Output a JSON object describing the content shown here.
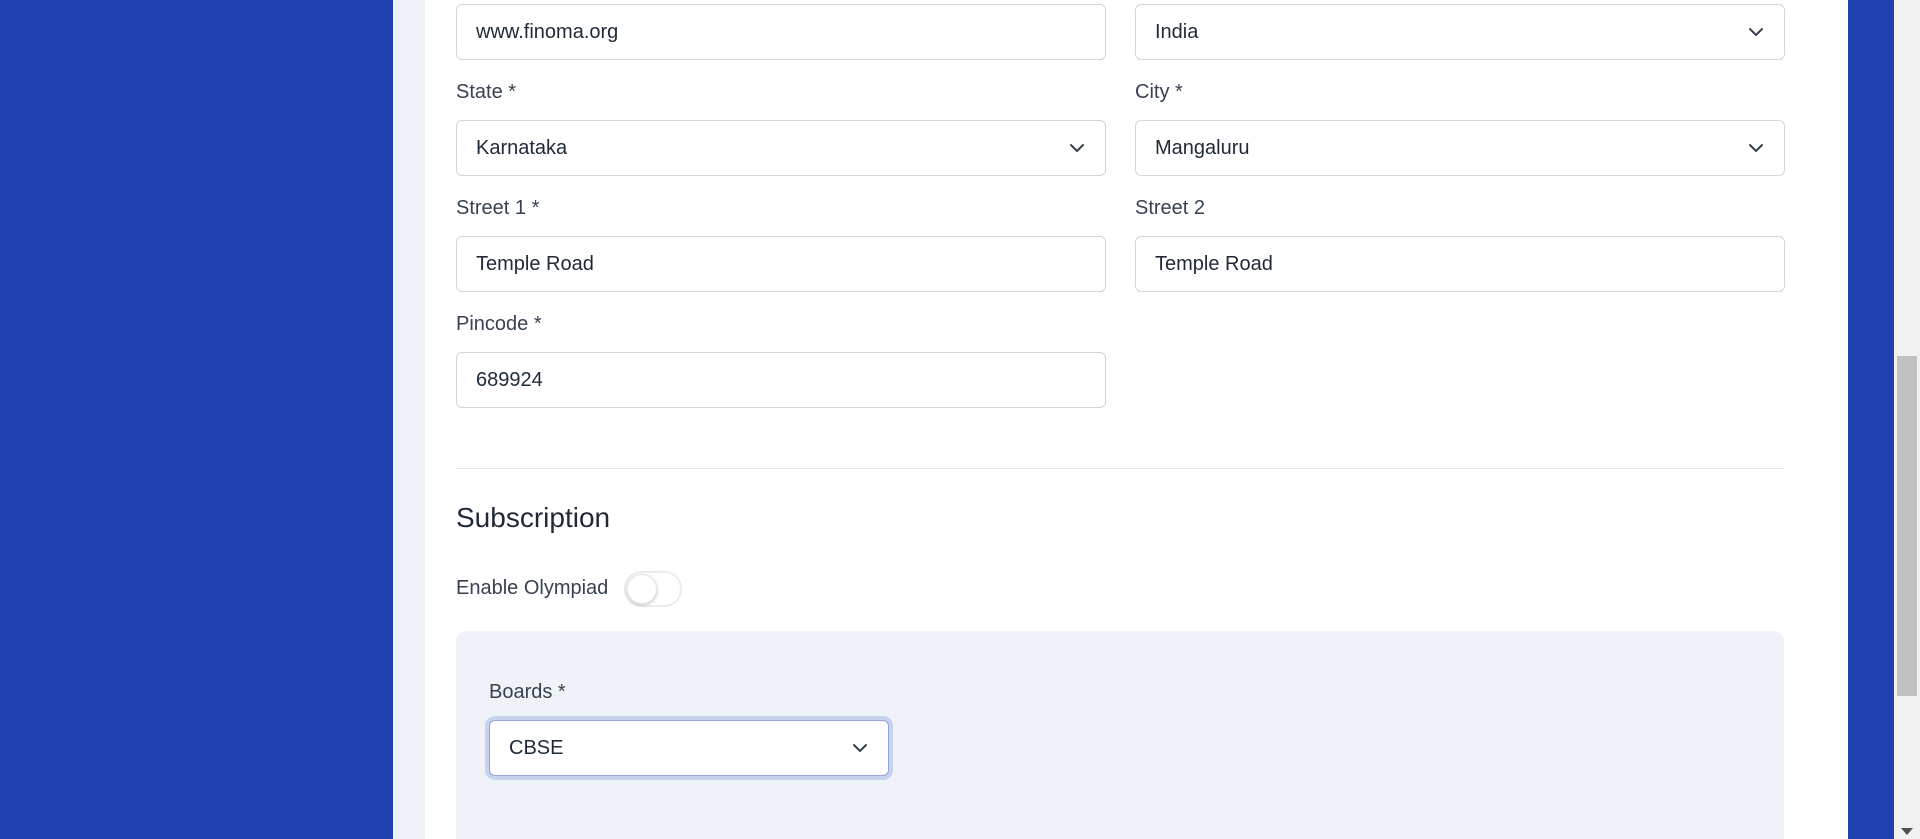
{
  "form": {
    "website": {
      "value": "www.finoma.org"
    },
    "country": {
      "value": "India"
    },
    "state": {
      "label": "State *",
      "value": "Karnataka"
    },
    "city": {
      "label": "City *",
      "value": "Mangaluru"
    },
    "street1": {
      "label": "Street 1 *",
      "value": "Temple Road"
    },
    "street2": {
      "label": "Street 2",
      "value": "Temple Road"
    },
    "pincode": {
      "label": "Pincode *",
      "value": "689924"
    }
  },
  "subscription": {
    "title": "Subscription",
    "olympiad_label": "Enable Olympiad",
    "olympiad_enabled": false,
    "boards": {
      "label": "Boards *",
      "value": "CBSE"
    }
  },
  "icons": {
    "dropdown": "chevron-down-icon",
    "scroll_down": "triangle-down-icon"
  },
  "colors": {
    "background": "#1e40af",
    "card": "#ffffff",
    "focus_ring": "#c7d2ee"
  }
}
